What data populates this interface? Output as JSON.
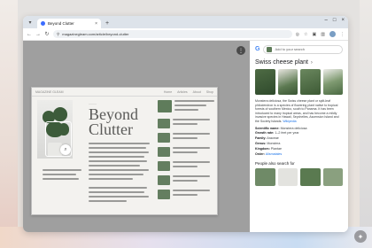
{
  "browser": {
    "tab_title": "Beyond Clutter",
    "tab_close": "×",
    "new_tab": "+",
    "url": "magazinegleam.com/article/beyond-clutter",
    "window_controls": [
      "–",
      "□",
      "×"
    ],
    "icons": [
      "back-icon",
      "forward-icon",
      "reload-icon",
      "lock-icon",
      "star-icon",
      "extensions-icon",
      "menu-icon"
    ]
  },
  "page": {
    "menu_icon": "⋮",
    "article": {
      "site_name": "MAGAZINE GLEAM",
      "nav_links": [
        "Home",
        "Articles",
        "About",
        "Shop"
      ],
      "headline_line1": "Beyond",
      "headline_line2": "Clutter"
    }
  },
  "panel": {
    "search_placeholder": "Add to your search",
    "google": "G",
    "title": "Swiss cheese plant",
    "description": "Monstera deliciosa, the Swiss cheese plant or split-leaf philodendron is a species of flowering plant native to tropical forests of southern Mexico, south to Panama. It has been introduced to many tropical areas, and has become a mildly invasive species in Hawaii, Seychelles, Ascension Island and the Society Islands.",
    "description_link": "Wikipedia",
    "facts": [
      {
        "label": "Scientific name:",
        "value": "Monstera deliciosa",
        "link": false
      },
      {
        "label": "Growth rate:",
        "value": "1–2 feet per year",
        "link": true
      },
      {
        "label": "Family:",
        "value": "Araceae",
        "link": false
      },
      {
        "label": "Genus:",
        "value": "Monstera",
        "link": false
      },
      {
        "label": "Kingdom:",
        "value": "Plantae",
        "link": false
      },
      {
        "label": "Order:",
        "value": "Alismatales",
        "link": true
      }
    ],
    "also_search": "People also search for"
  },
  "colors": {
    "accent": "#1a73e8",
    "tab_bar": "#dde3ea",
    "leaf": "#3c5b3a"
  }
}
